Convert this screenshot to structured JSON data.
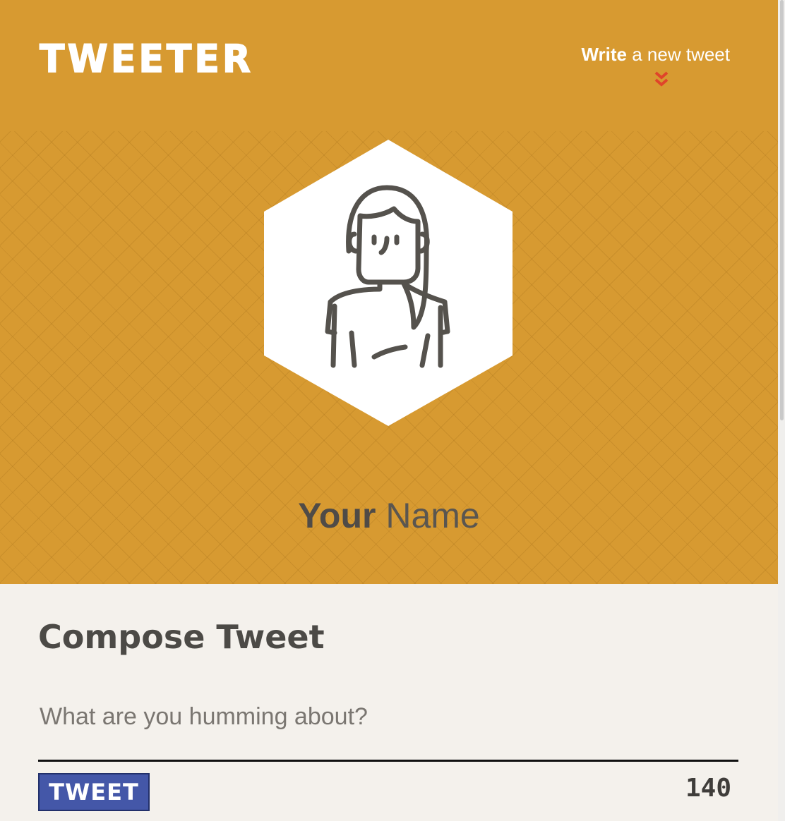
{
  "header": {
    "logo": "TWEETER",
    "write_strong": "Write",
    "write_rest": " a new tweet"
  },
  "profile": {
    "first_name": "Your",
    "last_name": "Name"
  },
  "compose": {
    "title": "Compose Tweet",
    "placeholder": "What are you humming about?",
    "input_value": "",
    "button_label": "TWEET",
    "counter": "140"
  },
  "colors": {
    "hero_background": "#d79a31",
    "accent_chevron": "#e0442a",
    "tweet_button": "#4457a8",
    "compose_background": "#f4f1ec"
  },
  "icons": {
    "nav_arrow": "double-chevron-down-icon",
    "avatar": "woman-avatar-icon"
  }
}
